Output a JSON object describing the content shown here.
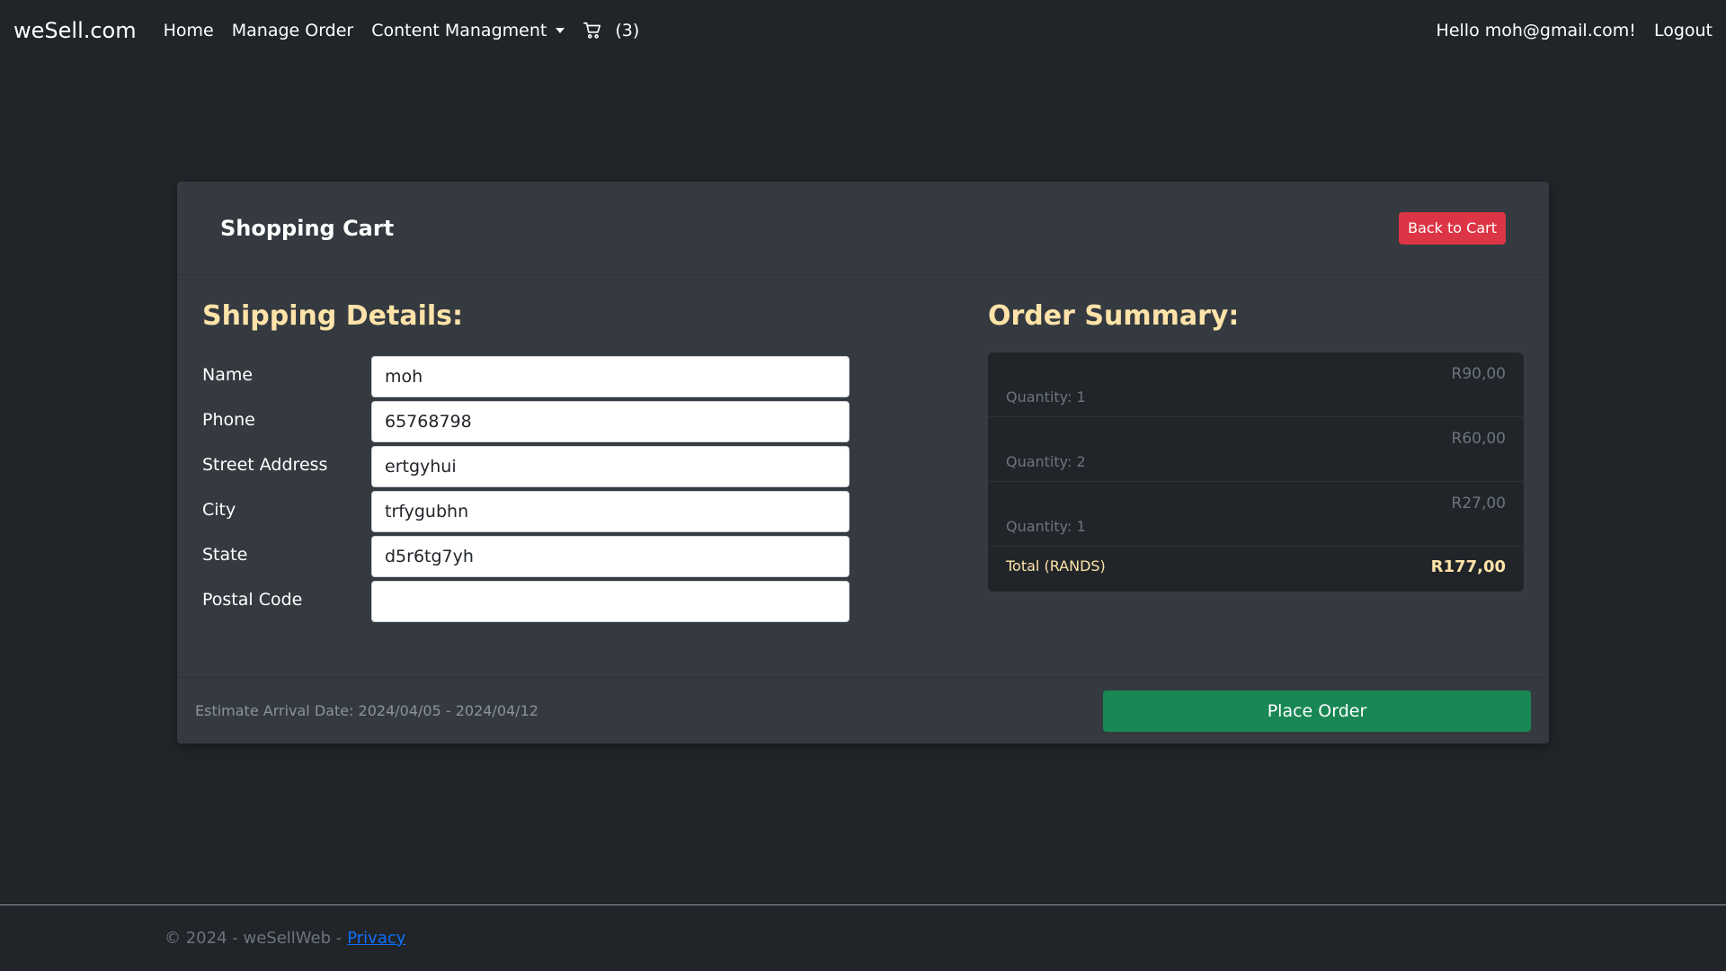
{
  "navbar": {
    "brand": "weSell.com",
    "links": {
      "home": "Home",
      "manage_order": "Manage Order",
      "content": "Content Managment"
    },
    "cart_count": "(3)",
    "greeting": "Hello moh@gmail.com!",
    "logout": "Logout"
  },
  "card": {
    "title": "Shopping Cart",
    "back_button": "Back to Cart"
  },
  "shipping": {
    "title": "Shipping Details:",
    "fields": {
      "name": {
        "label": "Name",
        "value": "moh"
      },
      "phone": {
        "label": "Phone",
        "value": "65768798"
      },
      "street": {
        "label": "Street Address",
        "value": "ertgyhui"
      },
      "city": {
        "label": "City",
        "value": "trfygubhn"
      },
      "state": {
        "label": "State",
        "value": "d5r6tg7yh"
      },
      "postal": {
        "label": "Postal Code",
        "value": ""
      }
    }
  },
  "summary": {
    "title": "Order Summary:",
    "items": [
      {
        "price": "R90,00",
        "quantity": "Quantity: 1"
      },
      {
        "price": "R60,00",
        "quantity": "Quantity: 2"
      },
      {
        "price": "R27,00",
        "quantity": "Quantity: 1"
      }
    ],
    "total_label": "Total (RANDS)",
    "total_value": "R177,00"
  },
  "footer_card": {
    "estimate": "Estimate Arrival Date: 2024/04/05 - 2024/04/12",
    "place_order": "Place Order"
  },
  "footer": {
    "copyright": "© 2024 - weSellWeb -",
    "privacy": "Privacy"
  },
  "colors": {
    "background": "#212529",
    "card": "#343a40",
    "accent_heading": "#ffe3a8",
    "danger": "#dc3545",
    "success": "#198754",
    "link": "#0d6efd"
  }
}
